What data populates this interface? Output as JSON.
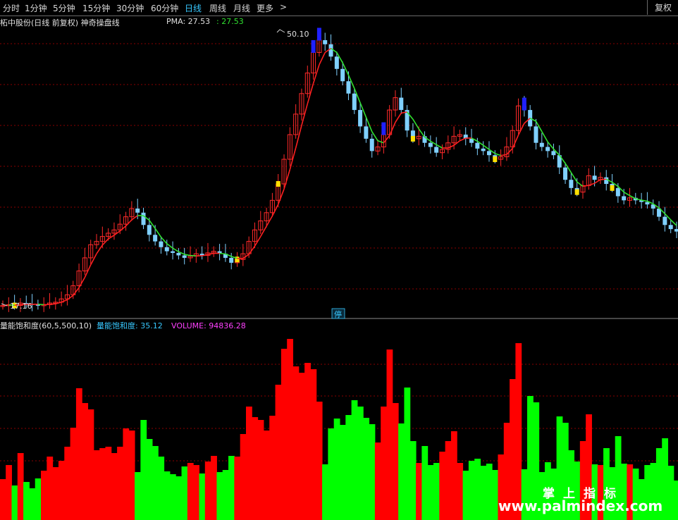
{
  "toolbar": {
    "tabs": [
      "分时",
      "1分钟",
      "5分钟",
      "15分钟",
      "30分钟",
      "60分钟",
      "日线",
      "周线",
      "月线",
      "更多"
    ],
    "active_tab": "日线",
    "more_arrow": ">",
    "adjust_button": "复权"
  },
  "main_panel": {
    "stock_title": "柘中股份(日线 前复权) 神奇操盘线",
    "indicator_label": "PMA: 27.53",
    "indicator_value": ": 27.53",
    "high_label": "50.10",
    "low_label": "17.16",
    "suspend_marker": "停"
  },
  "volume_panel": {
    "title": "量能饱和度(60,5,500,10)",
    "value_label": "量能饱和度: 35.12",
    "volume_label": "VOLUME: 94836.28"
  },
  "watermark": {
    "line1": "掌上指标",
    "line2": "www.palmindex.com"
  },
  "colors": {
    "up": "#ff2a2a",
    "down_candle": "#7fd0ff",
    "volume_up": "#ff0000",
    "volume_down": "#00ff00",
    "ma_up": "#ff2020",
    "ma_down": "#30e030",
    "blue_bar": "#2020ff",
    "yellow_bar": "#ffe000",
    "cyan_text": "#37c8ff",
    "magenta_text": "#ff40ff"
  },
  "chart_data": {
    "type": "candlestick+bar",
    "price_range": [
      17.16,
      50.1
    ],
    "price_path": [
      17.2,
      17.3,
      17.2,
      17.5,
      17.4,
      17.3,
      17.2,
      17.3,
      17.5,
      17.6,
      18.0,
      18.5,
      19.6,
      21.4,
      23.0,
      24.6,
      25.0,
      25.6,
      26.0,
      26.4,
      27.1,
      28.0,
      29.0,
      28.5,
      27.0,
      25.8,
      25.0,
      24.3,
      23.8,
      23.6,
      23.3,
      23.0,
      23.2,
      23.5,
      23.3,
      23.6,
      23.8,
      23.5,
      23.0,
      22.4,
      22.8,
      23.5,
      25.0,
      26.4,
      27.5,
      28.5,
      30.0,
      32.0,
      35.0,
      38.0,
      40.5,
      43.0,
      45.5,
      48.0,
      49.5,
      49.0,
      47.5,
      46.0,
      44.5,
      43.0,
      41.0,
      39.0,
      37.5,
      36.0,
      36.5,
      38.0,
      41.0,
      42.5,
      41.0,
      38.5,
      37.5,
      37.8,
      37.0,
      36.5,
      35.8,
      36.2,
      37.0,
      37.8,
      38.0,
      37.5,
      37.0,
      36.3,
      36.0,
      35.5,
      35.0,
      35.3,
      36.5,
      38.5,
      41.5,
      41.0,
      39.0,
      37.0,
      36.5,
      36.0,
      35.5,
      34.0,
      32.5,
      31.5,
      31.0,
      31.8,
      33.0,
      32.5,
      32.8,
      32.0,
      31.5,
      30.5,
      30.0,
      30.3,
      30.0,
      29.8,
      29.5,
      29.0,
      28.0,
      27.0,
      26.5,
      26.2
    ],
    "volume_label": "VOLUME: 94836.28"
  }
}
